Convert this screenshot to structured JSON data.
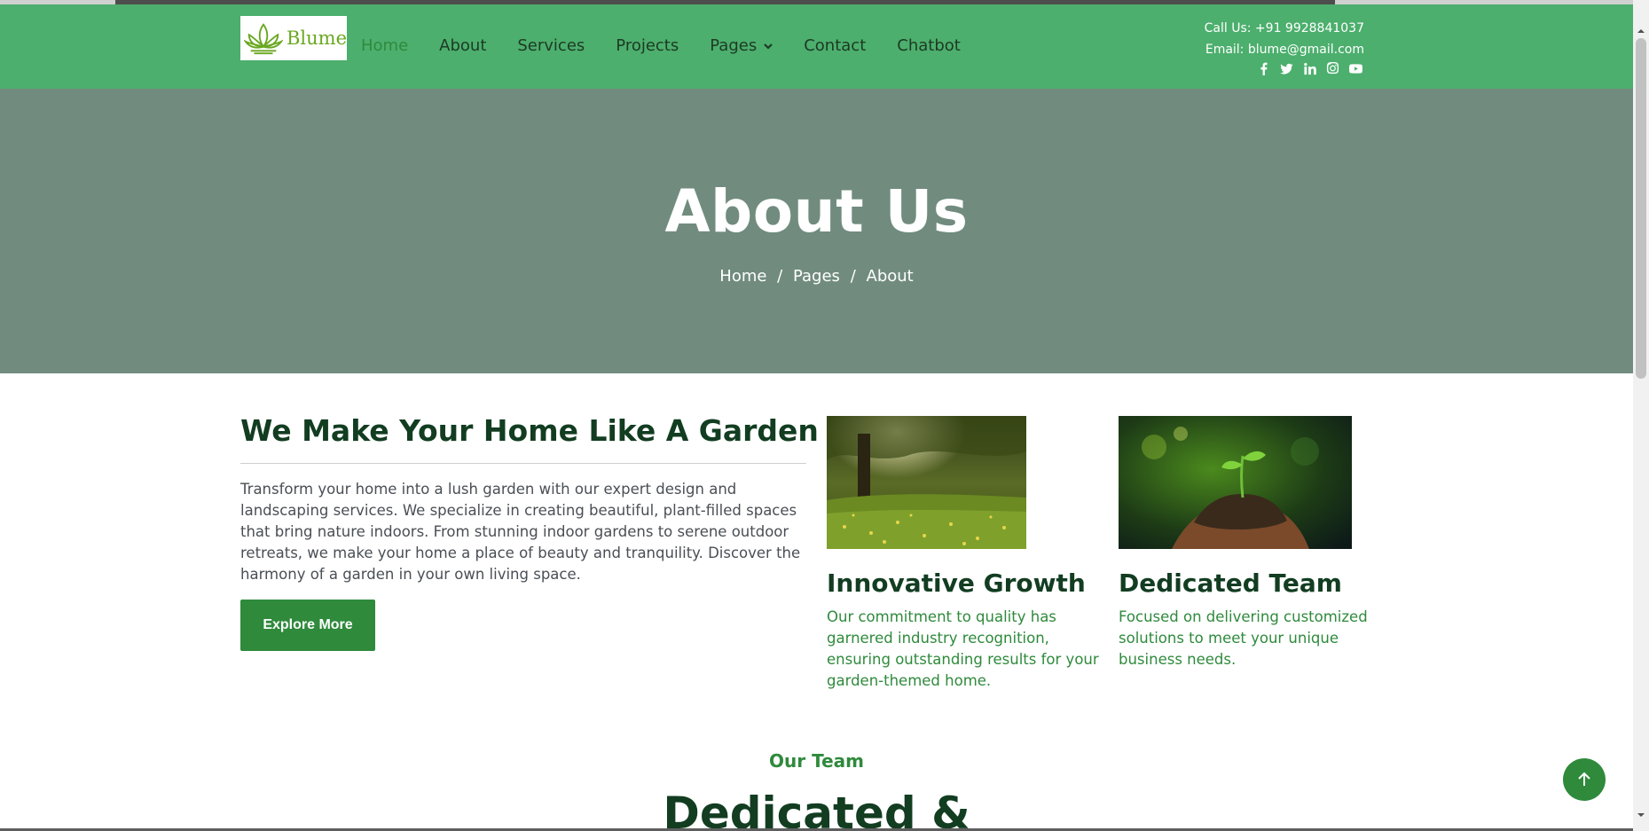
{
  "brand": {
    "logo_text": "Blume",
    "accent": "#4caf6d",
    "primary": "#2f8a3c",
    "dark": "#123d21"
  },
  "nav": {
    "items": [
      {
        "label": "Home",
        "active": true
      },
      {
        "label": "About"
      },
      {
        "label": "Services"
      },
      {
        "label": "Projects"
      },
      {
        "label": "Pages",
        "dropdown": true
      },
      {
        "label": "Contact"
      },
      {
        "label": "Chatbot"
      }
    ]
  },
  "contact": {
    "phone": "Call Us: +91 9928841037",
    "email": "Email: blume@gmail.com",
    "socials": [
      "facebook-icon",
      "twitter-icon",
      "linkedin-icon",
      "instagram-icon",
      "youtube-icon"
    ]
  },
  "hero": {
    "title": "About Us",
    "breadcrumb": [
      "Home",
      "Pages",
      "About"
    ],
    "separator": "/"
  },
  "about": {
    "headline": "We Make Your Home Like A Garden",
    "description": "Transform your home into a lush garden with our expert design and landscaping services. We specialize in creating beautiful, plant-filled spaces that bring nature indoors. From stunning indoor gardens to serene outdoor retreats, we make your home a place of beauty and tranquility. Discover the harmony of a garden in your own living space.",
    "button": "Explore More"
  },
  "cards": [
    {
      "title": "Innovative Growth",
      "text": "Our commitment to quality has garnered industry recognition, ensuring outstanding results for your garden-themed home."
    },
    {
      "title": "Dedicated Team",
      "text": "Focused on delivering customized solutions to meet your unique business needs."
    }
  ],
  "team": {
    "label": "Our Team",
    "heading": "Dedicated &"
  }
}
